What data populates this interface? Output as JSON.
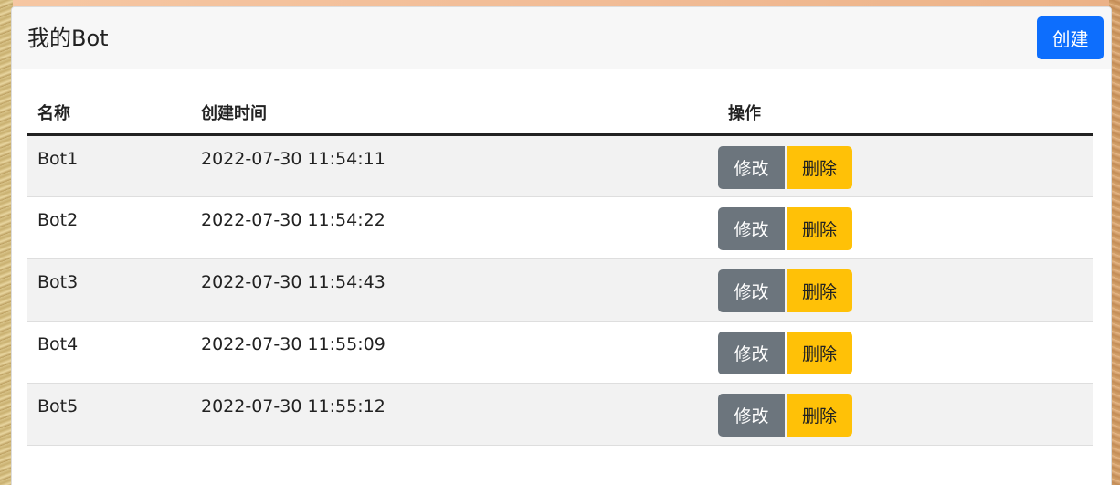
{
  "card": {
    "title": "我的Bot",
    "create_label": "创建"
  },
  "table": {
    "headers": {
      "name": "名称",
      "created": "创建时间",
      "actions": "操作"
    },
    "rows": [
      {
        "name": "Bot1",
        "created": "2022-07-30 11:54:11",
        "edit": "修改",
        "delete": "删除"
      },
      {
        "name": "Bot2",
        "created": "2022-07-30 11:54:22",
        "edit": "修改",
        "delete": "删除"
      },
      {
        "name": "Bot3",
        "created": "2022-07-30 11:54:43",
        "edit": "修改",
        "delete": "删除"
      },
      {
        "name": "Bot4",
        "created": "2022-07-30 11:55:09",
        "edit": "修改",
        "delete": "删除"
      },
      {
        "name": "Bot5",
        "created": "2022-07-30 11:55:12",
        "edit": "修改",
        "delete": "删除"
      }
    ]
  },
  "colors": {
    "primary": "#0d6efd",
    "secondary": "#6c757d",
    "warning": "#ffc107"
  }
}
